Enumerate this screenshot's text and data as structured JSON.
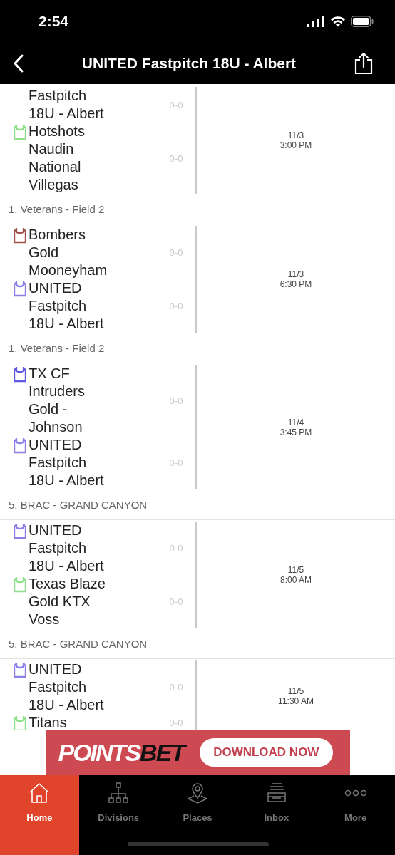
{
  "status_bar": {
    "time": "2:54"
  },
  "nav": {
    "title": "UNITED Fastpitch 18U - Albert"
  },
  "games": [
    {
      "teams": [
        {
          "lines": [
            "Fastpitch",
            "18U - Albert"
          ],
          "score": "0-0"
        },
        {
          "lines": [
            "Hotshots",
            "Naudin",
            "National",
            "Villegas"
          ],
          "score": "0-0",
          "color": "#8fe08a"
        }
      ],
      "date": "11/3",
      "time": "3:00 PM",
      "location": "1. Veterans - Field 2"
    },
    {
      "teams": [
        {
          "lines": [
            "Bombers",
            "Gold",
            "Mooneyham"
          ],
          "score": "0-0",
          "color": "#a0524f"
        },
        {
          "lines": [
            "UNITED",
            "Fastpitch",
            "18U - Albert"
          ],
          "score": "0-0",
          "color": "#8a80e8"
        }
      ],
      "date": "11/3",
      "time": "6:30 PM",
      "location": "1. Veterans - Field 2"
    },
    {
      "teams": [
        {
          "lines": [
            "TX CF",
            "Intruders",
            "Gold -",
            "Johnson"
          ],
          "score": "0-0",
          "color": "#5f58e0"
        },
        {
          "lines": [
            "UNITED",
            "Fastpitch",
            "18U - Albert"
          ],
          "score": "0-0",
          "color": "#8a80e8"
        }
      ],
      "date": "11/4",
      "time": "3:45 PM",
      "location": "5. BRAC - GRAND CANYON"
    },
    {
      "teams": [
        {
          "lines": [
            "UNITED",
            "Fastpitch",
            "18U - Albert"
          ],
          "score": "0-0",
          "color": "#8a80e8"
        },
        {
          "lines": [
            "Texas Blaze",
            "Gold KTX",
            "Voss"
          ],
          "score": "0-0",
          "color": "#8fe08a"
        }
      ],
      "date": "11/5",
      "time": "8:00 AM",
      "location": "5. BRAC - GRAND CANYON"
    },
    {
      "teams": [
        {
          "lines": [
            "UNITED",
            "Fastpitch",
            "18U - Albert"
          ],
          "score": "0-0",
          "color": "#8a80e8"
        },
        {
          "lines": [
            "Titans"
          ],
          "score": "0-0",
          "color": "#8fe08a"
        }
      ],
      "date": "11/5",
      "time": "11:30 AM"
    }
  ],
  "ad": {
    "brand_light": "POINTS",
    "brand_dark": "BET",
    "button": "DOWNLOAD NOW"
  },
  "tabs": [
    {
      "label": "Home",
      "kind": "home",
      "selected": true
    },
    {
      "label": "Divisions",
      "kind": "divisions",
      "selected": false
    },
    {
      "label": "Places",
      "kind": "places",
      "selected": false
    },
    {
      "label": "Inbox",
      "kind": "inbox",
      "selected": false
    },
    {
      "label": "More",
      "kind": "more",
      "selected": false
    }
  ]
}
